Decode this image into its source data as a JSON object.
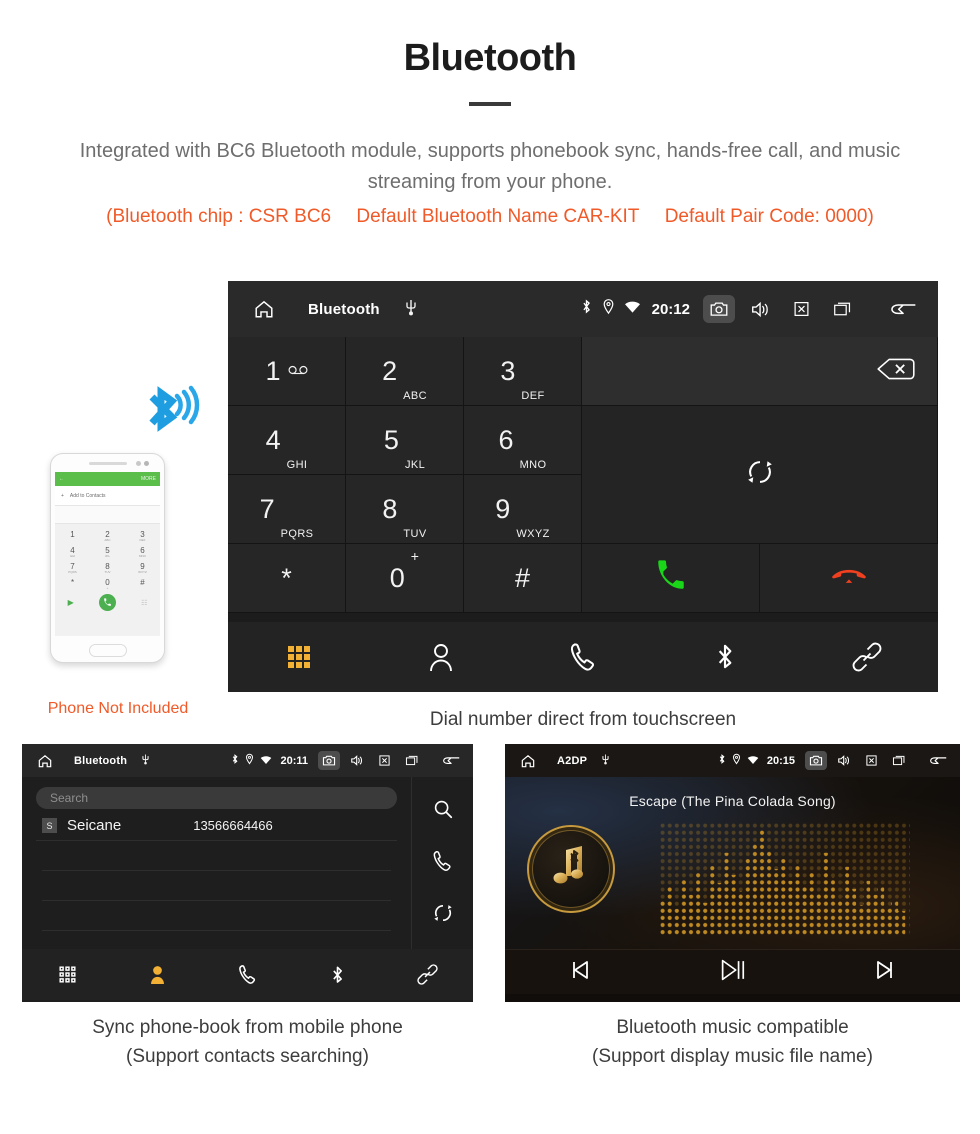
{
  "header": {
    "title": "Bluetooth",
    "description": "Integrated with BC6 Bluetooth module, supports phonebook sync, hands-free call, and music streaming from your phone.",
    "spec_chip": "(Bluetooth chip : CSR BC6",
    "spec_name": "Default Bluetooth Name CAR-KIT",
    "spec_pair": "Default Pair Code: 0000)",
    "accent_color": "#f05a28"
  },
  "dialer": {
    "statusbar": {
      "home_icon": "home-icon",
      "title": "Bluetooth",
      "usb_icon": "usb-icon",
      "bluetooth_icon": "bluetooth-icon",
      "location_icon": "location-icon",
      "wifi_icon": "wifi-icon",
      "time": "20:12",
      "camera_icon": "camera-icon",
      "volume_icon": "volume-icon",
      "close_icon": "close-box-icon",
      "recents_icon": "recents-icon",
      "back_icon": "back-icon"
    },
    "keys": [
      {
        "num": "1",
        "sub": "voicemail-icon"
      },
      {
        "num": "2",
        "sub": "ABC"
      },
      {
        "num": "3",
        "sub": "DEF"
      },
      {
        "num": "4",
        "sub": "GHI"
      },
      {
        "num": "5",
        "sub": "JKL"
      },
      {
        "num": "6",
        "sub": "MNO"
      },
      {
        "num": "7",
        "sub": "PQRS"
      },
      {
        "num": "8",
        "sub": "TUV"
      },
      {
        "num": "9",
        "sub": "WXYZ"
      },
      {
        "num": "*",
        "sub": ""
      },
      {
        "num": "0",
        "sub": "+"
      },
      {
        "num": "#",
        "sub": ""
      }
    ],
    "number_display": "",
    "backspace_icon": "backspace-icon",
    "sync_icon": "sync-icon",
    "call_icon": "call-icon",
    "hangup_icon": "hangup-icon",
    "call_color": "#19d619",
    "hangup_color": "#f04020",
    "nav": [
      {
        "icon": "keypad-icon",
        "active": true
      },
      {
        "icon": "contacts-icon",
        "active": false
      },
      {
        "icon": "call-log-icon",
        "active": false
      },
      {
        "icon": "bluetooth-icon",
        "active": false
      },
      {
        "icon": "link-icon",
        "active": false
      }
    ],
    "active_color": "#f2b134",
    "caption": "Dial number direct from touchscreen"
  },
  "phone_mock": {
    "bar_back_icon": "back-arrow-icon",
    "bar_more": "MORE",
    "add_contact": "Add to Contacts",
    "keys": [
      {
        "num": "1",
        "sub": ""
      },
      {
        "num": "2",
        "sub": "ABC"
      },
      {
        "num": "3",
        "sub": "DEF"
      },
      {
        "num": "4",
        "sub": "GHI"
      },
      {
        "num": "5",
        "sub": "JKL"
      },
      {
        "num": "6",
        "sub": "MNO"
      },
      {
        "num": "7",
        "sub": "PQRS"
      },
      {
        "num": "8",
        "sub": "TUV"
      },
      {
        "num": "9",
        "sub": "WXYZ"
      },
      {
        "num": "*",
        "sub": ""
      },
      {
        "num": "0",
        "sub": "+"
      },
      {
        "num": "#",
        "sub": ""
      }
    ],
    "note": "Phone Not Included",
    "note_color": "#f05a28"
  },
  "phonebook": {
    "statusbar": {
      "title": "Bluetooth",
      "time": "20:11"
    },
    "search_placeholder": "Search",
    "contacts": [
      {
        "initial": "S",
        "name": "Seicane",
        "number": "13566664466"
      }
    ],
    "side_icons": [
      "search-icon",
      "call-icon",
      "sync-icon"
    ],
    "nav": [
      {
        "icon": "keypad-icon",
        "active": false
      },
      {
        "icon": "contacts-icon",
        "active": true
      },
      {
        "icon": "call-log-icon",
        "active": false
      },
      {
        "icon": "bluetooth-icon",
        "active": false
      },
      {
        "icon": "link-icon",
        "active": false
      }
    ],
    "caption_line1": "Sync phone-book from mobile phone",
    "caption_line2": "(Support contacts searching)"
  },
  "music": {
    "statusbar": {
      "title": "A2DP",
      "time": "20:15"
    },
    "song_title": "Escape (The Pina Colada Song)",
    "album_icon": "bluetooth-music-note-icon",
    "controls": [
      {
        "icon": "previous-track-icon"
      },
      {
        "icon": "play-pause-icon"
      },
      {
        "icon": "next-track-icon"
      }
    ],
    "accent_color": "#c79a3e",
    "caption_line1": "Bluetooth music compatible",
    "caption_line2": "(Support display music file name)"
  }
}
